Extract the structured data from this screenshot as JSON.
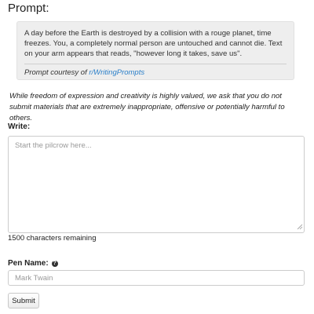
{
  "prompt": {
    "heading": "Prompt:",
    "text": "A day before the Earth is destroyed by a collision with a rouge planet, time freezes. You, a completely normal person are untouched and cannot die. Text on your arm appears that reads, \"however long it takes, save us\".",
    "courtesy_prefix": "Prompt courtesy of ",
    "courtesy_link": "r/WritingPrompts",
    "link_color": "#2a7fc9"
  },
  "disclaimer": "While freedom of expression and creativity is highly valued, we ask that you do not submit materials that are extremely inappropriate, offensive or potentially harmful to others.",
  "write": {
    "label": "Write:",
    "placeholder": "Start the pilcrow here...",
    "value": "",
    "chars_remaining": "1500 characters remaining"
  },
  "pen_name": {
    "label": "Pen Name:",
    "help_icon": "question-circle-icon",
    "placeholder": "Mark Twain",
    "value": ""
  },
  "submit": {
    "label": "Submit"
  }
}
